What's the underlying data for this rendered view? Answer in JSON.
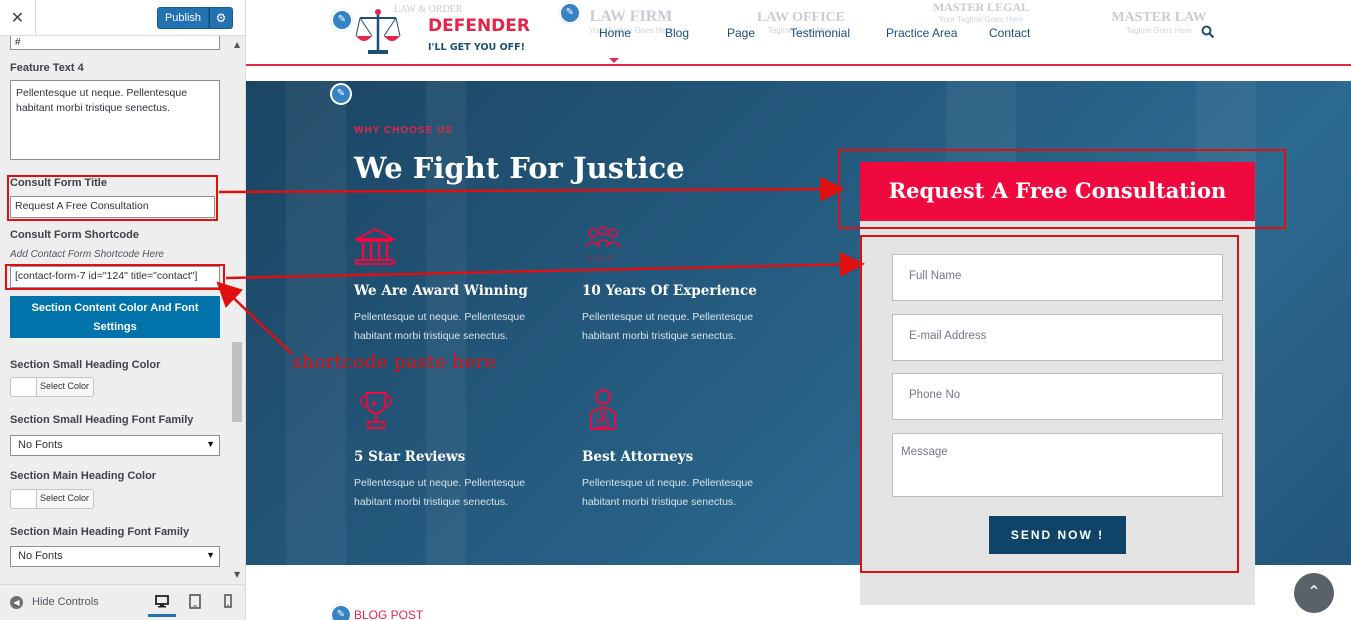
{
  "customizer": {
    "close_icon": "close-icon",
    "publish_label": "Publish",
    "gear_icon": "gear-icon",
    "prev_field_value": "#",
    "feature_text_4_label": "Feature Text 4",
    "feature_text_4_value": "Pellentesque ut neque. Pellentesque habitant morbi tristique senectus.",
    "consult_form_title_label": "Consult Form Title",
    "consult_form_title_value": "Request A Free Consultation",
    "consult_form_shortcode_label": "Consult Form Shortcode",
    "consult_form_shortcode_desc": "Add Contact Form Shortcode Here",
    "consult_form_shortcode_value": "[contact-form-7 id=\"124\" title=\"contact\"]",
    "section_content_button": "Section Content Color And Font Settings",
    "small_heading_color_label": "Section Small Heading Color",
    "select_color_label": "Select Color",
    "small_heading_font_label": "Section Small Heading Font Family",
    "no_fonts": "No Fonts",
    "main_heading_color_label": "Section Main Heading Color",
    "main_heading_font_label": "Section Main Heading Font Family",
    "hide_controls_label": "Hide Controls"
  },
  "site": {
    "logo_top": "LAW & ORDER",
    "logo_name": "DEFENDER",
    "logo_tagline": "I'LL GET YOU OFF!",
    "ghost_logos": [
      {
        "name": "LAW FIRM",
        "tag": "Your Tagline Goes Here"
      },
      {
        "name": "LAW OFFICE",
        "tag": "Tagline Goes Here"
      },
      {
        "name": "MASTER LEGAL",
        "tag": "Your Tagline Goes Here"
      },
      {
        "name": "MASTER LAW",
        "tag": "Tagline Goes Here"
      }
    ],
    "nav": [
      "Home",
      "Blog",
      "Page",
      "Testimonial",
      "Practice Area",
      "Contact"
    ],
    "search_icon": "search-icon",
    "small_heading": "WHY CHOOSE US",
    "main_heading": "We Fight For Justice",
    "features": [
      {
        "icon": "courthouse-icon",
        "title": "We Are Award Winning",
        "text": "Pellentesque ut neque. Pellentesque habitant morbi tristique senectus."
      },
      {
        "icon": "team-stars-icon",
        "title": "10 Years Of Experience",
        "text": "Pellentesque ut neque. Pellentesque habitant morbi tristique senectus."
      },
      {
        "icon": "trophy-icon",
        "title": "5 Star Reviews",
        "text": "Pellentesque ut neque. Pellentesque habitant morbi tristique senectus."
      },
      {
        "icon": "attorney-icon",
        "title": "Best Attorneys",
        "text": "Pellentesque ut neque. Pellentesque habitant morbi tristique senectus."
      }
    ],
    "form_title": "Request A Free Consultation",
    "form_fields": [
      "Full Name",
      "E-mail Address",
      "Phone No",
      "Message"
    ],
    "send_label": "SEND NOW !",
    "blog_heading": "BLOG POST"
  },
  "annotation": {
    "text": "shortcode paste here",
    "color": "#e01010"
  },
  "colors": {
    "accent": "#f0093f",
    "navy": "#0f4468",
    "wp_blue": "#2271b1"
  }
}
